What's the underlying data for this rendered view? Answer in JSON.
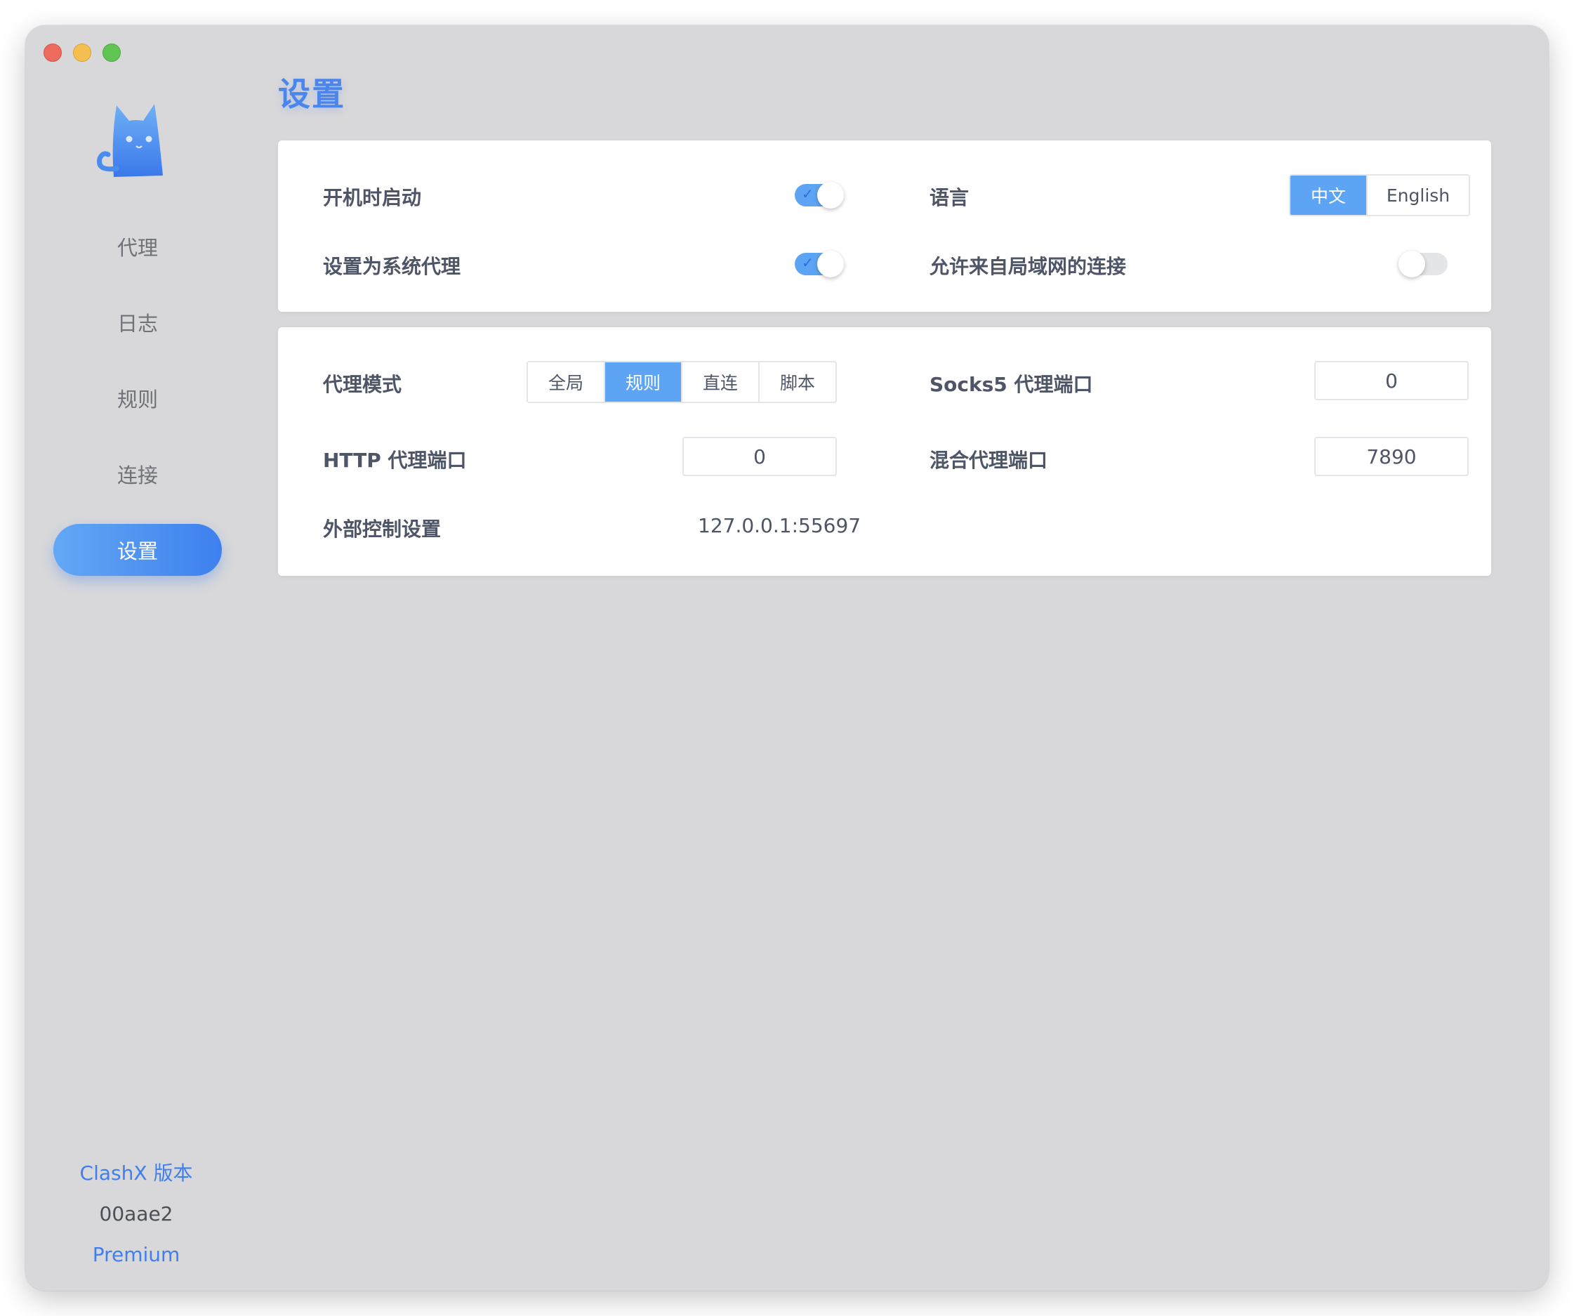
{
  "window": {
    "traffic_lights": [
      "close",
      "minimize",
      "zoom"
    ]
  },
  "sidebar": {
    "logo": "cat-logo",
    "items": [
      {
        "label": "代理",
        "active": false
      },
      {
        "label": "日志",
        "active": false
      },
      {
        "label": "规则",
        "active": false
      },
      {
        "label": "连接",
        "active": false
      },
      {
        "label": "设置",
        "active": true
      }
    ],
    "footer": {
      "version_label": "ClashX 版本",
      "version_hash": "00aae2",
      "edition": "Premium"
    }
  },
  "page": {
    "title": "设置"
  },
  "general": {
    "launch_at_login": {
      "label": "开机时启动",
      "enabled": true
    },
    "system_proxy": {
      "label": "设置为系统代理",
      "enabled": true
    },
    "language": {
      "label": "语言",
      "options": [
        "中文",
        "English"
      ],
      "selected": "中文"
    },
    "allow_lan": {
      "label": "允许来自局域网的连接",
      "enabled": false
    }
  },
  "proxy": {
    "mode": {
      "label": "代理模式",
      "options": [
        "全局",
        "规则",
        "直连",
        "脚本"
      ],
      "selected": "规则"
    },
    "socks5_port": {
      "label": "Socks5 代理端口",
      "value": "0"
    },
    "http_port": {
      "label": "HTTP 代理端口",
      "value": "0"
    },
    "mixed_port": {
      "label": "混合代理端口",
      "value": "7890"
    },
    "external_controller": {
      "label": "外部控制设置",
      "value": "127.0.0.1:55697"
    }
  },
  "colors": {
    "accent": "#5ea4f5",
    "title": "#4a86ee",
    "window_bg": "#d8d8da",
    "card_bg": "#ffffff"
  }
}
